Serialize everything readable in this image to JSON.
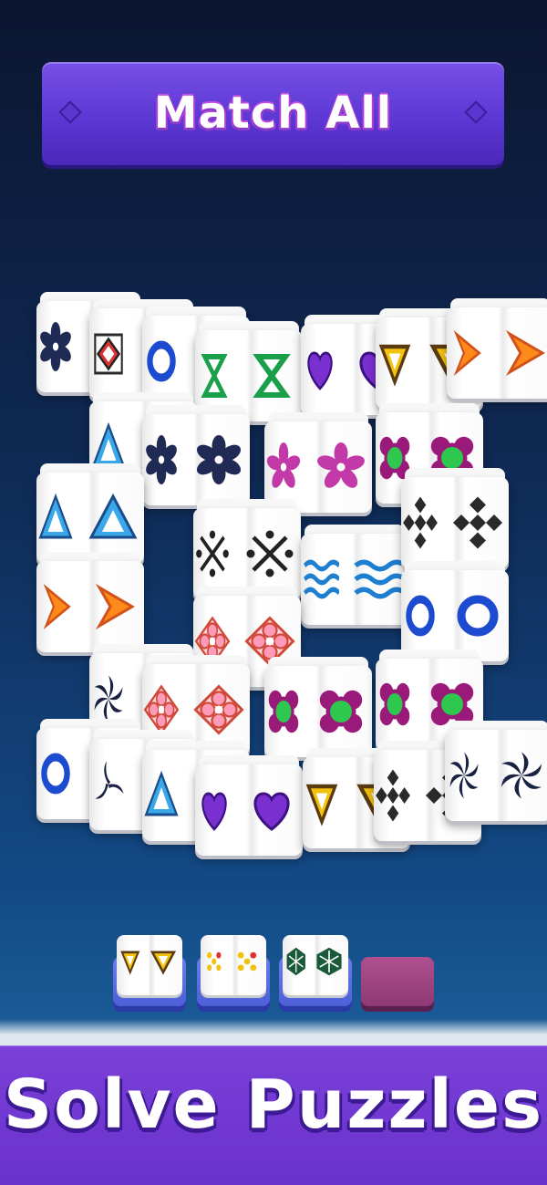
{
  "banner": {
    "title": "Match All"
  },
  "caption": {
    "text": "Solve Puzzles"
  },
  "tray": {
    "slots": [
      {
        "icon": "yellow-triangle-icon",
        "filled": true
      },
      {
        "icon": "dice-dots-icon",
        "filled": true
      },
      {
        "icon": "green-snowflake-icon",
        "filled": true
      },
      {
        "icon": "",
        "filled": false
      }
    ]
  },
  "colors": {
    "banner": "#5a35d2",
    "background_top": "#0b1630",
    "background_bottom": "#1a5a96",
    "caption_bar": "#6a32cc",
    "empty_slot": "#9e4482"
  },
  "tiles": [
    {
      "icon": "navy-flower-icon"
    },
    {
      "icon": "diamond-square-icon"
    },
    {
      "icon": "blue-ring-icon"
    },
    {
      "icon": "green-hourglass-icon"
    },
    {
      "icon": "purple-heart-icon"
    },
    {
      "icon": "yellow-triangle-icon"
    },
    {
      "icon": "orange-chevron-icon"
    },
    {
      "icon": "blue-triangle-icon"
    },
    {
      "icon": "navy-flower-icon"
    },
    {
      "icon": "pink-flower-icon"
    },
    {
      "icon": "green-circle-flower-icon"
    },
    {
      "icon": "blue-triangle-icon"
    },
    {
      "icon": "dark-x-icon"
    },
    {
      "icon": "blue-wave-icon"
    },
    {
      "icon": "dark-diamond-cross-icon"
    },
    {
      "icon": "orange-chevron-icon"
    },
    {
      "icon": "blue-ring-icon"
    },
    {
      "icon": "pink-ornament-icon"
    },
    {
      "icon": "pinwheel-icon"
    },
    {
      "icon": "pink-ornament-icon"
    },
    {
      "icon": "green-circle-flower-icon"
    },
    {
      "icon": "green-circle-flower-icon"
    },
    {
      "icon": "blue-ring-icon"
    },
    {
      "icon": "triskelion-icon"
    },
    {
      "icon": "blue-triangle-icon"
    },
    {
      "icon": "purple-heart-icon"
    },
    {
      "icon": "yellow-triangle-icon"
    },
    {
      "icon": "dark-diamond-cross-icon"
    },
    {
      "icon": "pinwheel-icon"
    }
  ]
}
